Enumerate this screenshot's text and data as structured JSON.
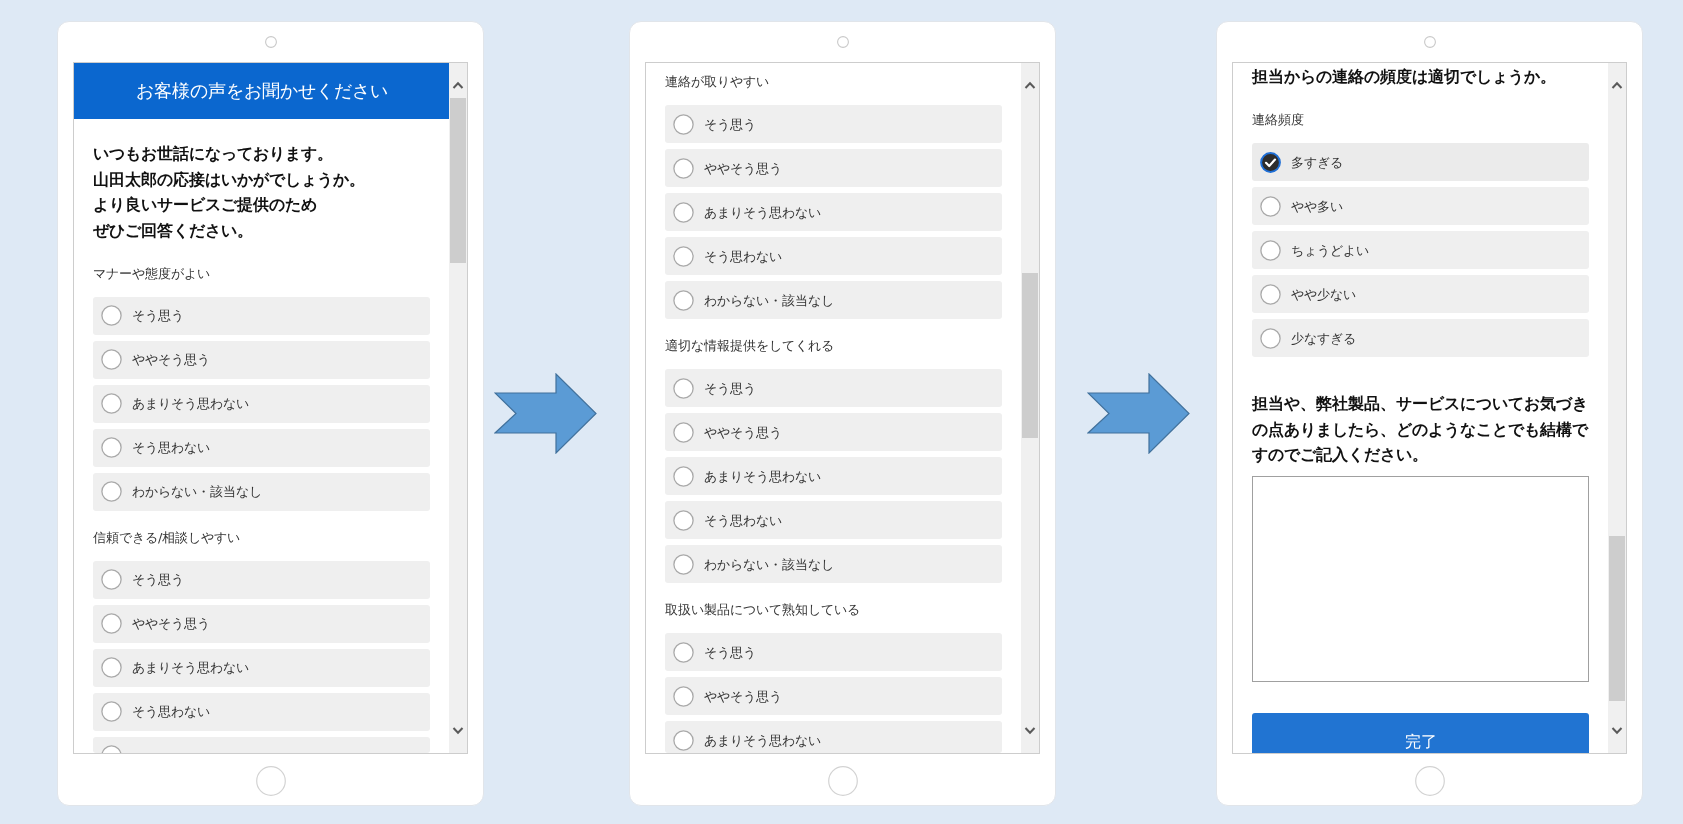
{
  "screens": [
    {
      "blocks": [
        {
          "kind": "banner",
          "text": "お客様の声をお聞かせください"
        },
        {
          "kind": "intro",
          "lines": [
            "いつもお世話になっております。",
            "山田太郎の応接はいかがでしょうか。",
            "より良いサービスご提供のため",
            "ぜひご回答ください。"
          ]
        },
        {
          "kind": "question",
          "label": "マナーや態度がよい",
          "options": [
            {
              "label": "そう思う",
              "selected": false
            },
            {
              "label": "ややそう思う",
              "selected": false
            },
            {
              "label": "あまりそう思わない",
              "selected": false
            },
            {
              "label": "そう思わない",
              "selected": false
            },
            {
              "label": "わからない・該当なし",
              "selected": false
            }
          ]
        },
        {
          "kind": "question",
          "label": "信頼できる/相談しやすい",
          "options": [
            {
              "label": "そう思う",
              "selected": false
            },
            {
              "label": "ややそう思う",
              "selected": false
            },
            {
              "label": "あまりそう思わない",
              "selected": false
            },
            {
              "label": "そう思わない",
              "selected": false
            },
            {
              "selected": false
            }
          ]
        }
      ]
    },
    {
      "blocks": [
        {
          "kind": "question",
          "label": "連絡が取りやすい",
          "options": [
            {
              "label": "そう思う",
              "selected": false
            },
            {
              "label": "ややそう思う",
              "selected": false
            },
            {
              "label": "あまりそう思わない",
              "selected": false
            },
            {
              "label": "そう思わない",
              "selected": false
            },
            {
              "label": "わからない・該当なし",
              "selected": false
            }
          ]
        },
        {
          "kind": "question",
          "label": "適切な情報提供をしてくれる",
          "options": [
            {
              "label": "そう思う",
              "selected": false
            },
            {
              "label": "ややそう思う",
              "selected": false
            },
            {
              "label": "あまりそう思わない",
              "selected": false
            },
            {
              "label": "そう思わない",
              "selected": false
            },
            {
              "label": "わからない・該当なし",
              "selected": false
            }
          ]
        },
        {
          "kind": "question",
          "label": "取扱い製品について熟知している",
          "options": [
            {
              "label": "そう思う",
              "selected": false
            },
            {
              "label": "ややそう思う",
              "selected": false
            },
            {
              "label": "あまりそう思わない",
              "selected": false
            }
          ]
        }
      ]
    },
    {
      "blocks": [
        {
          "kind": "heading",
          "text": "担当からの連絡の頻度は適切でしょうか。"
        },
        {
          "kind": "question",
          "label": "連絡頻度",
          "options": [
            {
              "label": "多すぎる",
              "selected": true
            },
            {
              "label": "やや多い",
              "selected": false
            },
            {
              "label": "ちょうどよい",
              "selected": false
            },
            {
              "label": "やや少ない",
              "selected": false
            },
            {
              "label": "少なすぎる",
              "selected": false
            }
          ]
        },
        {
          "kind": "comment",
          "prompt": "担当や、弊社製品、サービスについてお気づきの点ありましたら、どのようなことでも結構ですのでご記入ください。"
        },
        {
          "kind": "button",
          "label": "完了"
        }
      ]
    }
  ]
}
